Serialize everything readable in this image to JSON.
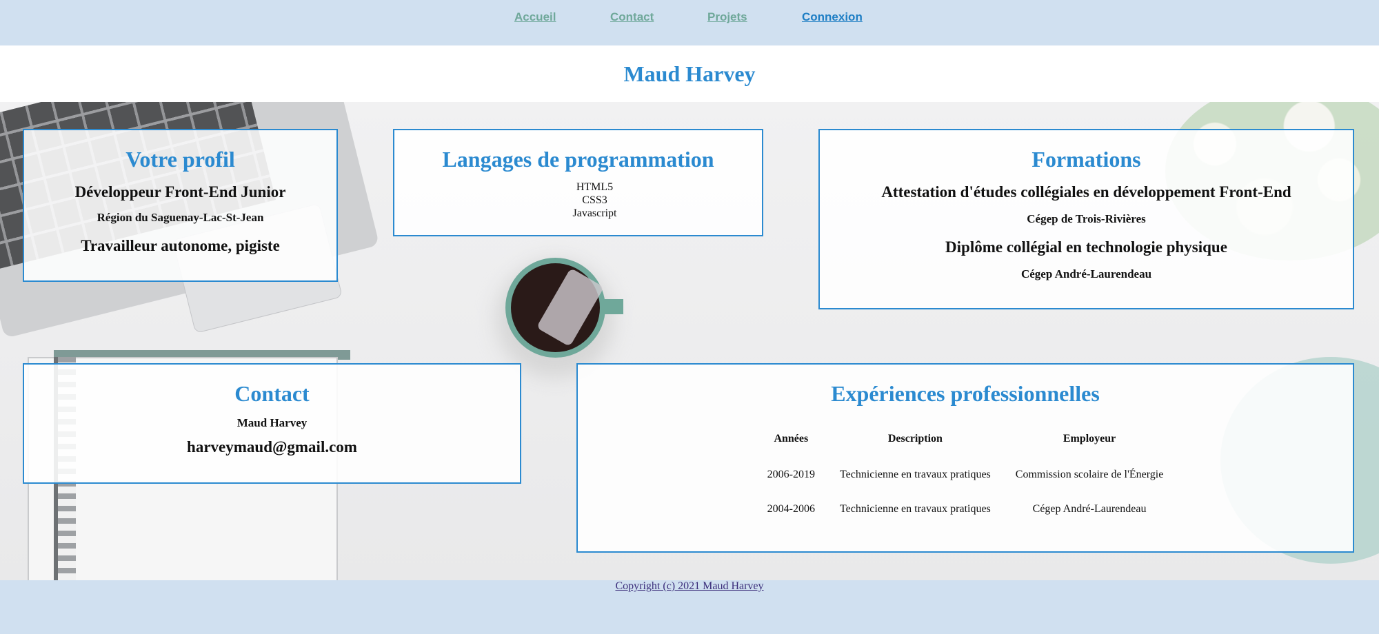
{
  "nav": {
    "items": [
      "Accueil",
      "Contact",
      "Projets",
      "Connexion"
    ],
    "active": "Connexion"
  },
  "header": {
    "title": "Maud Harvey"
  },
  "profil": {
    "title": "Votre profil",
    "role": "Développeur Front-End Junior",
    "region": "Région du Saguenay-Lac-St-Jean",
    "status": "Travailleur autonome, pigiste"
  },
  "langages": {
    "title": "Langages de programmation",
    "items": [
      "HTML5",
      "CSS3",
      "Javascript"
    ]
  },
  "formations": {
    "title": "Formations",
    "entries": [
      {
        "diploma": "Attestation d'études collégiales en développement Front-End",
        "school": "Cégep de Trois-Rivières"
      },
      {
        "diploma": "Diplôme collégial en technologie physique",
        "school": "Cégep André-Laurendeau"
      }
    ]
  },
  "contact": {
    "title": "Contact",
    "name": "Maud Harvey",
    "email": "harveymaud@gmail.com"
  },
  "experiences": {
    "title": "Expériences professionnelles",
    "headers": [
      "Années",
      "Description",
      "Employeur"
    ],
    "rows": [
      [
        "2006-2019",
        "Technicienne en travaux pratiques",
        "Commission scolaire de l'Énergie"
      ],
      [
        "2004-2006",
        "Technicienne en travaux pratiques",
        "Cégep André-Laurendeau"
      ]
    ]
  },
  "footer": {
    "copyright": "Copyright (c) 2021 Maud Harvey"
  },
  "colors": {
    "accent": "#2b8ad0",
    "nav_link": "#6fa89a",
    "nav_active": "#1e7ec4",
    "band": "#d0e0f0"
  }
}
